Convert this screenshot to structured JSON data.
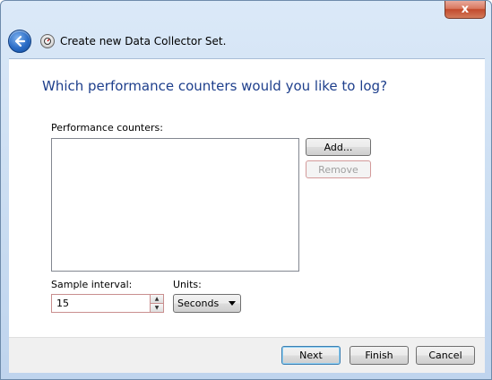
{
  "window": {
    "title": "Create new Data Collector Set.",
    "close_glyph": "x"
  },
  "page": {
    "heading": "Which performance counters would you like to log?",
    "counters_label": "Performance counters:",
    "add_label": "Add...",
    "remove_label": "Remove",
    "sample_interval_label": "Sample interval:",
    "sample_interval_value": "15",
    "units_label": "Units:",
    "units_value": "Seconds"
  },
  "footer": {
    "next_label": "Next",
    "finish_label": "Finish",
    "cancel_label": "Cancel"
  },
  "colors": {
    "heading": "#1e3f8c",
    "accent": "#2a6cc6"
  }
}
